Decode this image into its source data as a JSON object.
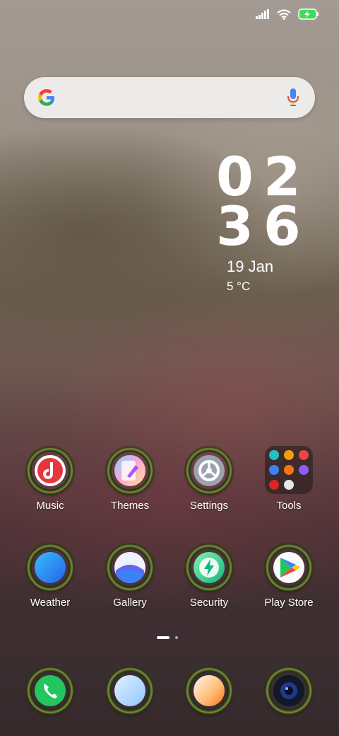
{
  "clock": {
    "hours": "02",
    "minutes": "36",
    "date": "19 Jan",
    "weather": "5 °C"
  },
  "apps_row1": [
    {
      "label": "Music"
    },
    {
      "label": "Themes"
    },
    {
      "label": "Settings"
    },
    {
      "label": "Tools"
    }
  ],
  "apps_row2": [
    {
      "label": "Weather"
    },
    {
      "label": "Gallery"
    },
    {
      "label": "Security"
    },
    {
      "label": "Play Store"
    }
  ],
  "dock": [
    {
      "icon": "phone-icon"
    },
    {
      "icon": "messages-icon"
    },
    {
      "icon": "browser-icon"
    },
    {
      "icon": "camera-icon"
    }
  ],
  "colors": {
    "battery": "#3ddc5a",
    "search_bg": "#ecebea"
  }
}
